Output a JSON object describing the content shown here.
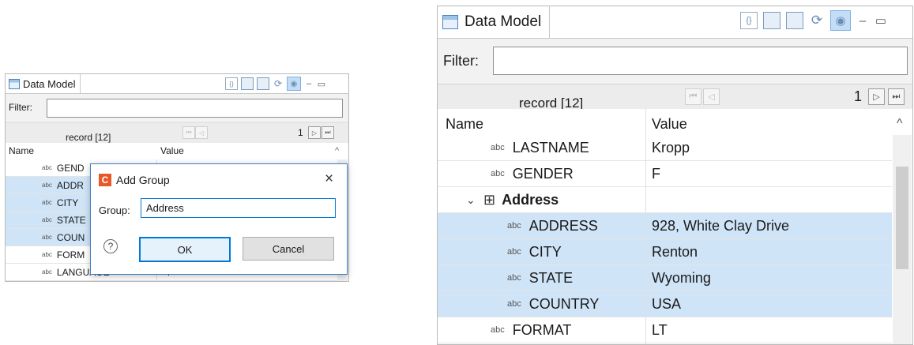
{
  "panel": {
    "tab_title": "Data Model",
    "filter_label": "Filter:",
    "filter_value": "",
    "record_label": "record [12]",
    "page_number": "1",
    "col_name": "Name",
    "col_value": "Value"
  },
  "small_rows": [
    {
      "name": "GEND",
      "value": "",
      "selected": false
    },
    {
      "name": "ADDR",
      "value": "",
      "selected": true
    },
    {
      "name": "CITY",
      "value": "",
      "selected": true
    },
    {
      "name": "STATE",
      "value": "",
      "selected": true
    },
    {
      "name": "COUN",
      "value": "",
      "selected": true
    },
    {
      "name": "FORM",
      "value": "",
      "selected": false
    },
    {
      "name": "LANGUAGE",
      "value": "F",
      "selected": false
    }
  ],
  "dialog": {
    "title": "Add Group",
    "group_label": "Group:",
    "group_value": "Address",
    "ok_label": "OK",
    "cancel_label": "Cancel",
    "help_glyph": "?",
    "close_glyph": "×",
    "logo_letter": "C"
  },
  "large_rows": [
    {
      "name": "LASTNAME",
      "value": "Kropp",
      "type": "abc",
      "selected": false
    },
    {
      "name": "GENDER",
      "value": "F",
      "type": "abc",
      "selected": false
    },
    {
      "name": "Address",
      "value": "",
      "type": "group",
      "selected": false
    },
    {
      "name": "ADDRESS",
      "value": "928, White Clay Drive",
      "type": "abc",
      "selected": true
    },
    {
      "name": "CITY",
      "value": "Renton",
      "type": "abc",
      "selected": true
    },
    {
      "name": "STATE",
      "value": "Wyoming",
      "type": "abc",
      "selected": true
    },
    {
      "name": "COUNTRY",
      "value": "USA",
      "type": "abc",
      "selected": true
    },
    {
      "name": "FORMAT",
      "value": "LT",
      "type": "abc",
      "selected": false
    }
  ],
  "icons": {
    "abc_glyph": "abc",
    "expand_glyph": "⌄",
    "group_glyph": "⊞",
    "sort_glyph": "^",
    "first_glyph": "⏮",
    "prev_glyph": "◁",
    "next_glyph": "▷",
    "last_glyph": "⏭",
    "minimize_glyph": "‒",
    "maximize_glyph": "▭",
    "eye_glyph": "◉"
  },
  "colors": {
    "selection": "#cfe4f7",
    "accent": "#0078d7",
    "logo": "#e8572a"
  }
}
